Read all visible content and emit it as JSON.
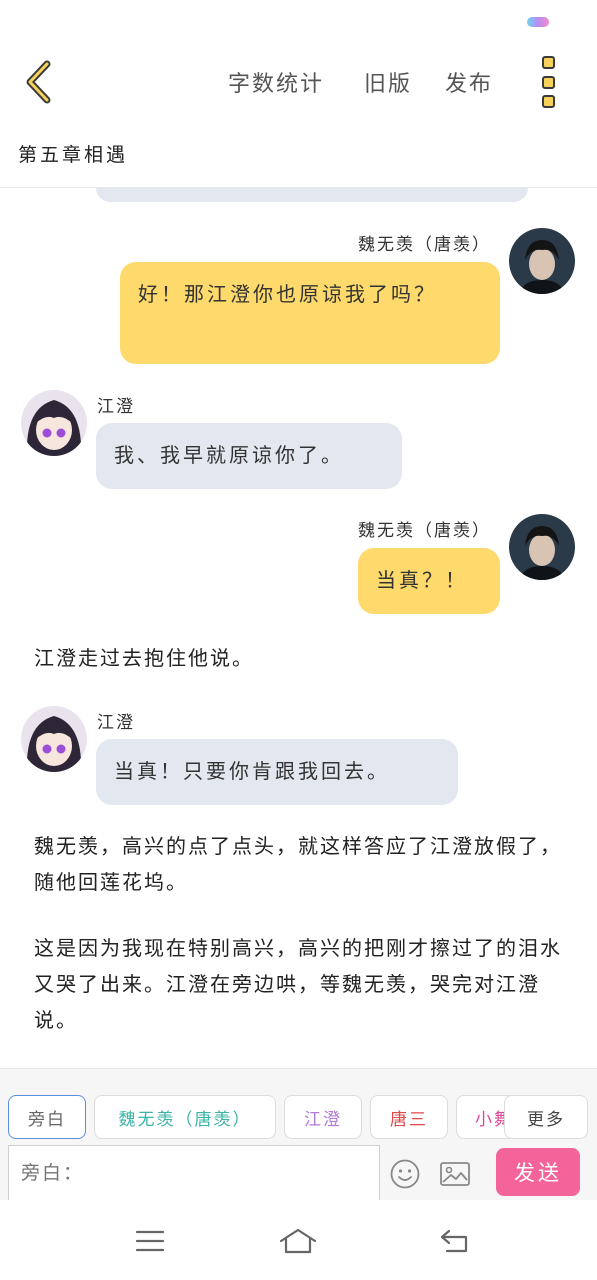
{
  "header": {
    "word_count": "字数统计",
    "old_version": "旧版",
    "publish": "发布"
  },
  "chapter": {
    "title": "第五章相遇"
  },
  "messages": [
    {
      "speaker": "魏无羡（唐羡）",
      "text": "好！那江澄你也原谅我了吗？"
    },
    {
      "speaker": "江澄",
      "text": "我、我早就原谅你了。"
    },
    {
      "speaker": "魏无羡（唐羡）",
      "text": "当真？！"
    },
    {
      "narration": "江澄走过去抱住他说。"
    },
    {
      "speaker": "江澄",
      "text": "当真！只要你肯跟我回去。"
    },
    {
      "narration": "魏无羡，高兴的点了点头，就这样答应了江澄放假了，随他回莲花坞。"
    },
    {
      "narration": "这是因为我现在特别高兴，高兴的把刚才擦过了的泪水又哭了出来。江澄在旁边哄，等魏无羡，哭完对江澄说。"
    }
  ],
  "roles": [
    {
      "label": "旁白",
      "color": "#666666"
    },
    {
      "label": "魏无羡（唐羡）",
      "color": "#3bb3a6"
    },
    {
      "label": "江澄",
      "color": "#b07ad6"
    },
    {
      "label": "唐三",
      "color": "#e04848"
    },
    {
      "label": "小舞",
      "color": "#e0489a"
    }
  ],
  "more_label": "更多",
  "composer": {
    "placeholder": "旁白：",
    "send_label": "发送"
  }
}
